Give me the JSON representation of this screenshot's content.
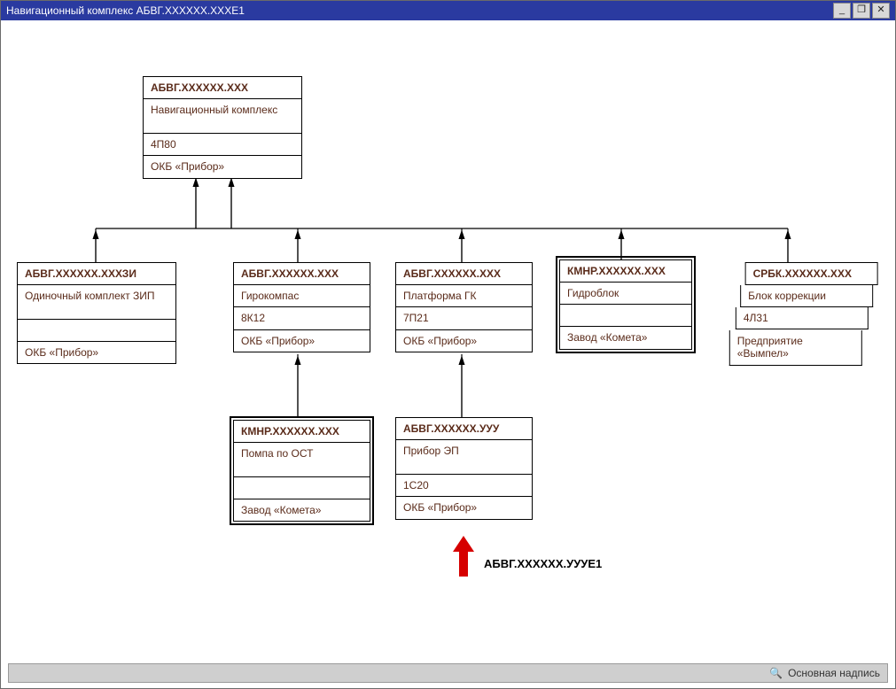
{
  "window": {
    "title": "Навигационный комплекс АБВГ.ХХХХХХ.ХХХЕ1",
    "buttons": {
      "minimize": "_",
      "maximize": "❐",
      "close": "✕"
    }
  },
  "statusbar": {
    "icon": "🔍",
    "label": "Основная надпись"
  },
  "annotation": {
    "label": "АБВГ.ХХХХХХ.УУУЕ1"
  },
  "nodes": {
    "root": {
      "code": "АБВГ.ХХХХХХ.ХХХ",
      "name": "Навигационный комплекс",
      "index": "4П80",
      "org": "ОКБ «Прибор»"
    },
    "zip": {
      "code": "АБВГ.ХХХХХХ.ХХХЗИ",
      "name": "Одиночный комплект ЗИП",
      "index": "",
      "org": "ОКБ «Прибор»"
    },
    "gyro": {
      "code": "АБВГ.ХХХХХХ.ХХХ",
      "name": "Гирокомпас",
      "index": "8К12",
      "org": "ОКБ «Прибор»"
    },
    "platform": {
      "code": "АБВГ.ХХХХХХ.ХХХ",
      "name": "Платформа ГК",
      "index": "7П21",
      "org": "ОКБ «Прибор»"
    },
    "hydro": {
      "code": "КМНР.ХХХХХХ.ХХХ",
      "name": "Гидроблок",
      "index": "",
      "org": "Завод «Комета»"
    },
    "corr": {
      "code": "СРБК.ХХХХХХ.ХХХ",
      "name": "Блок коррекции",
      "index": "4Л31",
      "org": "Предприятие «Вымпел»"
    },
    "pump": {
      "code": "КМНР.ХХХХХХ.ХХХ",
      "name": "Помпа по ОСТ",
      "index": "",
      "org": "Завод «Комета»"
    },
    "ep": {
      "code": "АБВГ.ХХХХХХ.УУУ",
      "name": "Прибор ЭП",
      "index": "1С20",
      "org": "ОКБ «Прибор»"
    }
  }
}
